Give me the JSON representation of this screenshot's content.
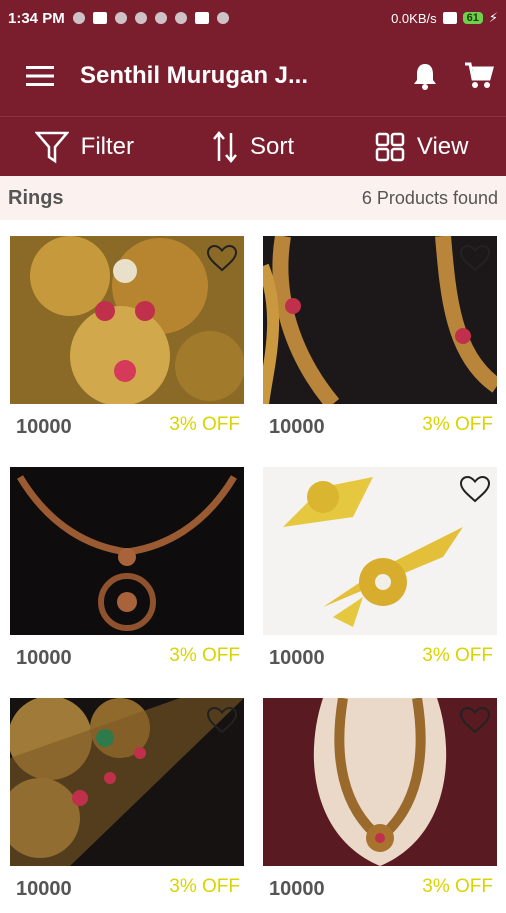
{
  "status_bar": {
    "time": "1:34 PM",
    "network_speed": "0.0KB/s",
    "battery": "61"
  },
  "app_bar": {
    "title": "Senthil Murugan J..."
  },
  "toolbar": {
    "filter_label": "Filter",
    "sort_label": "Sort",
    "view_label": "View"
  },
  "category": {
    "name": "Rings",
    "count_text": "6 Products found"
  },
  "products": [
    {
      "price": "10000",
      "discount": "3% OFF",
      "image": "gold temple necklace with rubies"
    },
    {
      "price": "10000",
      "discount": "3% OFF",
      "image": "long gold haaram on black"
    },
    {
      "price": "10000",
      "discount": "3% OFF",
      "image": "antique copper chain with pendant"
    },
    {
      "price": "10000",
      "discount": "3% OFF",
      "image": "gold earrings on white"
    },
    {
      "price": "10000",
      "discount": "3% OFF",
      "image": "antique gold bangle with rubies"
    },
    {
      "price": "10000",
      "discount": "3% OFF",
      "image": "long antique necklace on bust"
    }
  ],
  "colors": {
    "primary": "#7a1e2e",
    "discount": "#d9d400"
  }
}
